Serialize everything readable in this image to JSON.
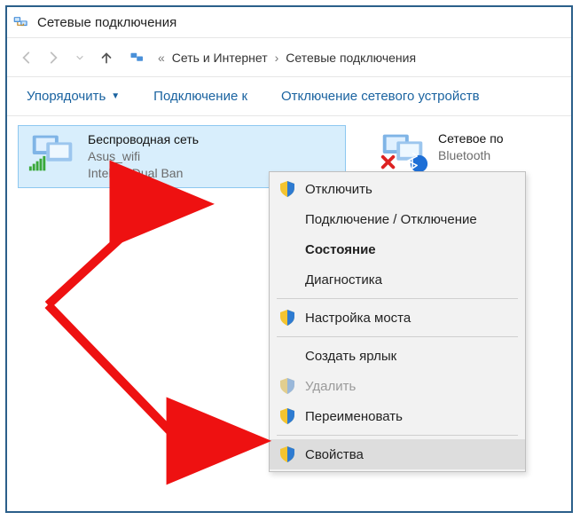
{
  "window": {
    "title": "Сетевые подключения"
  },
  "breadcrumb": {
    "part1": "Сеть и Интернет",
    "part2": "Сетевые подключения"
  },
  "toolbar": {
    "organize": "Упорядочить",
    "connect_to": "Подключение к",
    "disable_device": "Отключение сетевого устройств"
  },
  "connections": {
    "wifi": {
      "name": "Беспроводная сеть",
      "ssid": "Asus_wifi",
      "adapter": "Intel(R) Dual Ban"
    },
    "bt": {
      "name": "Сетевое по",
      "line2": "Bluetooth"
    }
  },
  "context_menu": {
    "disable": "Отключить",
    "toggle": "Подключение / Отключение",
    "status": "Состояние",
    "diagnose": "Диагностика",
    "bridge": "Настройка моста",
    "shortcut": "Создать ярлык",
    "delete": "Удалить",
    "rename": "Переименовать",
    "properties": "Свойства"
  }
}
